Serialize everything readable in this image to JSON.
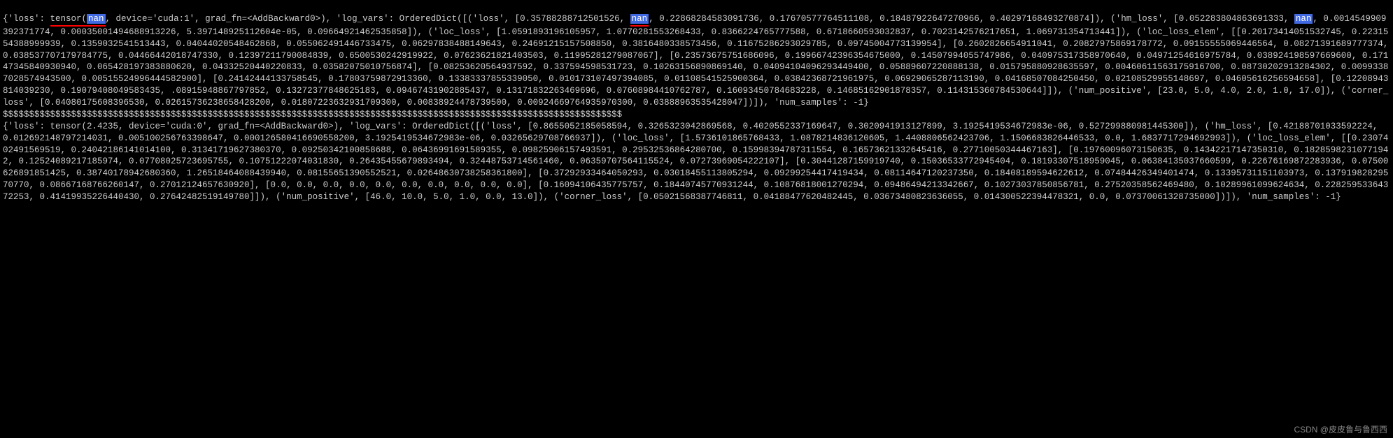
{
  "block1": {
    "prefix": "{'loss': ",
    "tensor_open": "tensor(",
    "nan1": "nan",
    "tensor_rest": ", device='cuda:1', grad_fn=<AddBackward0>), 'log_vars': OrderedDict([('loss', [0.35788288712501526, ",
    "nan2": "nan",
    "after_nan2_a": ", 0.22868284583091736, 0.17670577764511108, 0.18487922647270966, 0.40297168493270874]), ('hm_loss', [0.052283804863691333, ",
    "nan3": "nan",
    "after_nan3": ", 0.0014549909392371774, 0.00035001494688913226, 5.397148925112604e-05, 0.09664921462535858]), ('loc_loss', [1.0591893196105957, 1.0770281553268433, 0.8366224765777588, 0.6718660593032837, 0.7023142576217651, 1.069731354713441]), ('loc_loss_elem', [[0.20173414051532745, 0.2231554388999939, 0.1359032541513443, 0.04044020548462868, 0.055062491446733475, 0.06297838488149643, 0.24691215157508850, 0.3816480338573456, 0.11675286293029785, 0.09745004773139954], [0.2602826654911041, 0.20827975869178772, 0.09155555069446564, 0.08271391689777374, 0.038537707179784775, 0.04466442018747330, 0.12397211790084839, 0.6500530242919922, 0.07623621821403503, 0.11995281279087067], [0.23573675751686096, 0.19966742396354675000, 0.14507994055747986, 0.040975317358970640, 0.04971254616975784, 0.038924198597669600, 0.17147345840930940, 0.065428197383880620, 0.04332520440220833, 0.03582075010756874], [0.08253620564937592, 0.337594598531723, 0.10263156890869140, 0.04094104096293449400, 0.05889607220888138, 0.015795880928635597, 0.00460611563175916700, 0.08730202913284302, 0.00993387028574943500, 0.00515524996444582900], [0.24142444133758545, 0.17803759872913360, 0.13383337855339050, 0.010173107497394085, 0.01108541525900364, 0.03842368721961975, 0.06929065287113190, 0.04168507084250450, 0.02108529955148697, 0.04605616256594658], [0.12208943814039230, 0.19079408049583435, .08915948867797852, 0.13272377848625183, 0.09467431902885437, 0.13171832263469696, 0.07608984410762787, 0.16093450784683228, 0.14685162901878357, 0.114315360784530644]]), ('num_positive', [23.0, 5.0, 4.0, 2.0, 1.0, 17.0]), ('corner_loss', [0.04080175608396530, 0.02615736238658428200, 0.01807223632931709300, 0.00838924478739500, 0.00924669764935970300, 0.03888963535428047])]), 'num_samples': -1}"
  },
  "separator": "$$$$$$$$$$$$$$$$$$$$$$$$$$$$$$$$$$$$$$$$$$$$$$$$$$$$$$$$$$$$$$$$$$$$$$$$$$$$$$$$$$$$$$$$$$$$$$$$$$$$$$$$$$$$$$$$$$$$$$",
  "block2": "{'loss': tensor(2.4235, device='cuda:0', grad_fn=<AddBackward0>), 'log_vars': OrderedDict([('loss', [0.8655052185058594, 0.3265323042869568, 0.4020552337169647, 0.3020941913127899, 3.1925419534672983e-06, 0.527299880981445300]), ('hm_loss', [0.42188701033592224, 0.012692148797214031, 0.005100256763398647, 0.000126580416690558200, 3.1925419534672983e-06, 0.03265629708766937]), ('loc_loss', [1.5736101865768433, 1.0878214836120605, 1.4408806562423706, 1.1506683826446533, 0.0, 1.6837717294692993]), ('loc_loss_elem', [[0.2307402491569519, 0.24042186141014100, 0.31341719627380370, 0.09250342100858688, 0.06436991691589355, 0.09825906157493591, 0.29532536864280700, 0.15998394787311554, 0.16573621332645416, 0.27710050344467163], [0.19760096073150635, 0.14342217147350310, 0.18285982310771942, 0.12524089217185974, 0.07708025723695755, 0.10751222074031830, 0.26435455679893494, 0.32448753714561460, 0.06359707564115524, 0.07273969054222107], [0.30441287159919740, 0.15036533772945404, 0.18193307518959045, 0.06384135037660599, 0.22676169872283936, 0.07500626891851425, 0.38740178942680360, 1.26518464088439940, 0.08155651390552521, 0.02648630738258361800], [0.37292933464050293, 0.03018455113805294, 0.09299254417419434, 0.08114647120237350, 0.18408189594622612, 0.07484426349401474, 0.13395731151103973, 0.13791982829570770, 0.08667168766260147, 0.27012124657630920], [0.0, 0.0, 0.0, 0.0, 0.0, 0.0, 0.0, 0.0, 0.0, 0.0], [0.16094106435775757, 0.18440745770931244, 0.10876818001270294, 0.09486494213342667, 0.10273037850856781, 0.27520358562469480, 0.10289961099624634, 0.22825953364372253, 0.41419935226440430, 0.27642482519149780]]), ('num_positive', [46.0, 10.0, 5.0, 1.0, 0.0, 13.0]), ('corner_loss', [0.05021568387746811, 0.04188477620482445, 0.03673480823636055, 0.014300522394478321, 0.0, 0.07370061328735000])]), 'num_samples': -1}",
  "watermark": "CSDN @皮皮鲁与鲁西西"
}
